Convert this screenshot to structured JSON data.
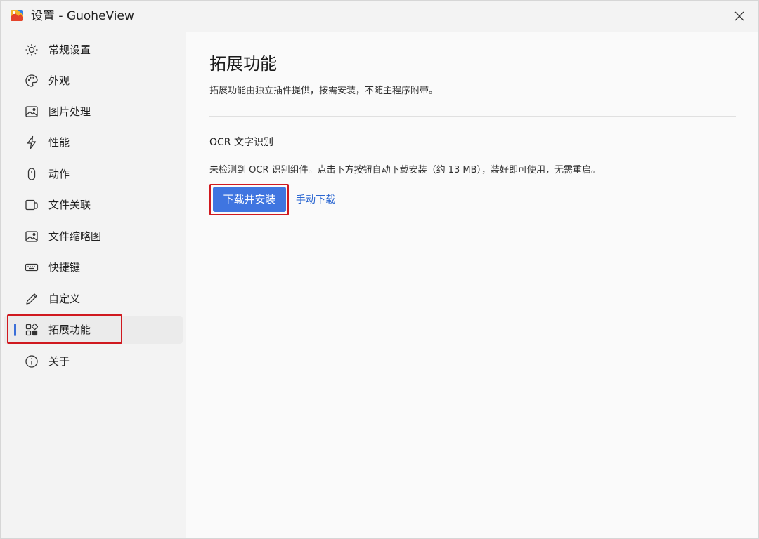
{
  "window": {
    "title": "设置 - GuoheView"
  },
  "sidebar": {
    "items": [
      {
        "label": "常规设置",
        "icon": "sun-gear-icon"
      },
      {
        "label": "外观",
        "icon": "palette-icon"
      },
      {
        "label": "图片处理",
        "icon": "image-icon"
      },
      {
        "label": "性能",
        "icon": "lightning-icon"
      },
      {
        "label": "动作",
        "icon": "mouse-icon"
      },
      {
        "label": "文件关联",
        "icon": "file-link-icon"
      },
      {
        "label": "文件缩略图",
        "icon": "thumbnail-icon"
      },
      {
        "label": "快捷键",
        "icon": "keyboard-icon"
      },
      {
        "label": "自定义",
        "icon": "pencil-icon"
      },
      {
        "label": "拓展功能",
        "icon": "apps-icon",
        "active": true
      },
      {
        "label": "关于",
        "icon": "info-icon"
      }
    ]
  },
  "main": {
    "title": "拓展功能",
    "description": "拓展功能由独立插件提供，按需安装，不随主程序附带。",
    "ocr": {
      "title": "OCR 文字识别",
      "status": "未检测到 OCR 识别组件。点击下方按钮自动下载安装（约 13 MB），装好即可使用，无需重启。",
      "install_label": "下载并安装",
      "manual_label": "手动下载"
    }
  },
  "colors": {
    "accent": "#3f75e0",
    "highlight_box": "#d0191f",
    "link": "#2a66d1"
  }
}
